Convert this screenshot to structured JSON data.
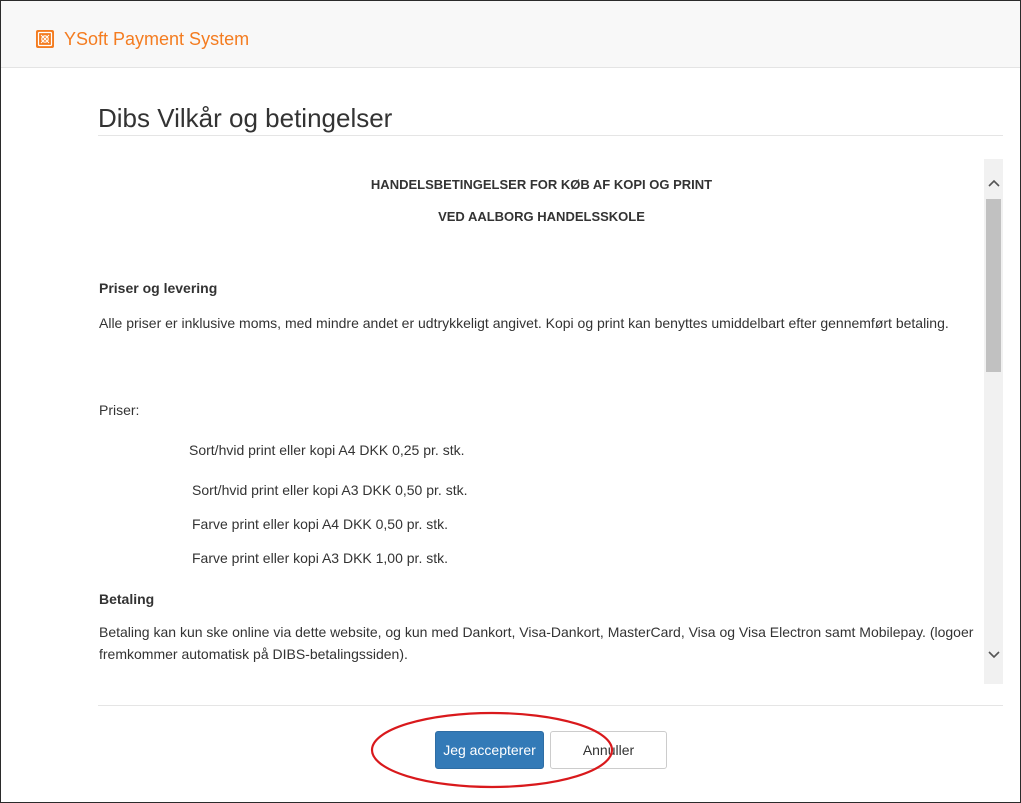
{
  "app": {
    "brand_name": "YSoft Payment System",
    "brand_color": "#f47c20",
    "brand_icon": "safe-icon"
  },
  "page": {
    "title": "Dibs Vilkår og betingelser"
  },
  "terms": {
    "heading_line1": "HANDELSBETINGELSER FOR KØB AF KOPI OG PRINT",
    "heading_line2": "VED AALBORG HANDELSSKOLE",
    "section1_title": "Priser og levering",
    "section1_text": "Alle priser er inklusive moms, med mindre andet er udtrykkeligt angivet. Kopi og print kan benyttes umiddelbart efter gennemført betaling.",
    "prices_label": "Priser:",
    "prices": [
      "Sort/hvid print eller kopi A4 DKK 0,25 pr. stk.",
      "Sort/hvid print eller kopi A3 DKK 0,50 pr. stk.",
      "Farve print eller kopi A4 DKK 0,50 pr. stk.",
      "Farve print eller kopi A3 DKK 1,00 pr. stk."
    ],
    "section2_title": "Betaling",
    "section2_text": "Betaling kan kun ske online via dette website, og kun med Dankort, Visa-Dankort, MasterCard, Visa og Visa Electron samt Mobilepay. (logoer fremkommer automatisk på DIBS-betalingssiden)."
  },
  "scrollbar": {
    "up_icon": "chevron-up-icon",
    "down_icon": "chevron-down-icon"
  },
  "buttons": {
    "accept_label": "Jeg accepterer",
    "cancel_label": "Annuller",
    "accept_color": "#337ab7"
  },
  "annotation": {
    "highlight_color": "#d9191c"
  }
}
